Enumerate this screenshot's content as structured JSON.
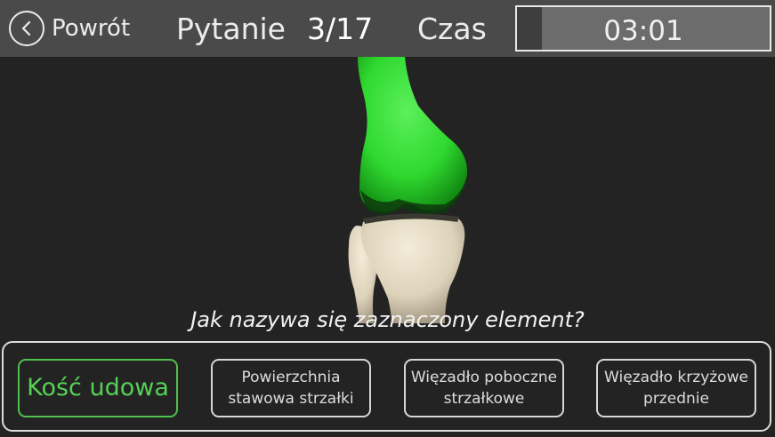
{
  "header": {
    "back_label": "Powrót",
    "question_label": "Pytanie",
    "question_counter": "3/17",
    "time_label": "Czas",
    "timer_value": "03:01",
    "timer_remaining": 0.9
  },
  "question": "Jak nazywa się zaznaczony element?",
  "answers": [
    {
      "label": "Kość udowa",
      "selected": true
    },
    {
      "label": "Powierzchnia stawowa strzałki",
      "selected": false
    },
    {
      "label": "Więzadło poboczne strzałkowe",
      "selected": false
    },
    {
      "label": "Więzadło krzyżowe przednie",
      "selected": false
    }
  ],
  "colors": {
    "highlight": "#2fd82f",
    "bone": "#ddd3bb",
    "selected": "#4ec14e",
    "header_bg": "#4a4a4a",
    "background": "#232323"
  },
  "icons": {
    "back": "chevron-left-icon"
  }
}
